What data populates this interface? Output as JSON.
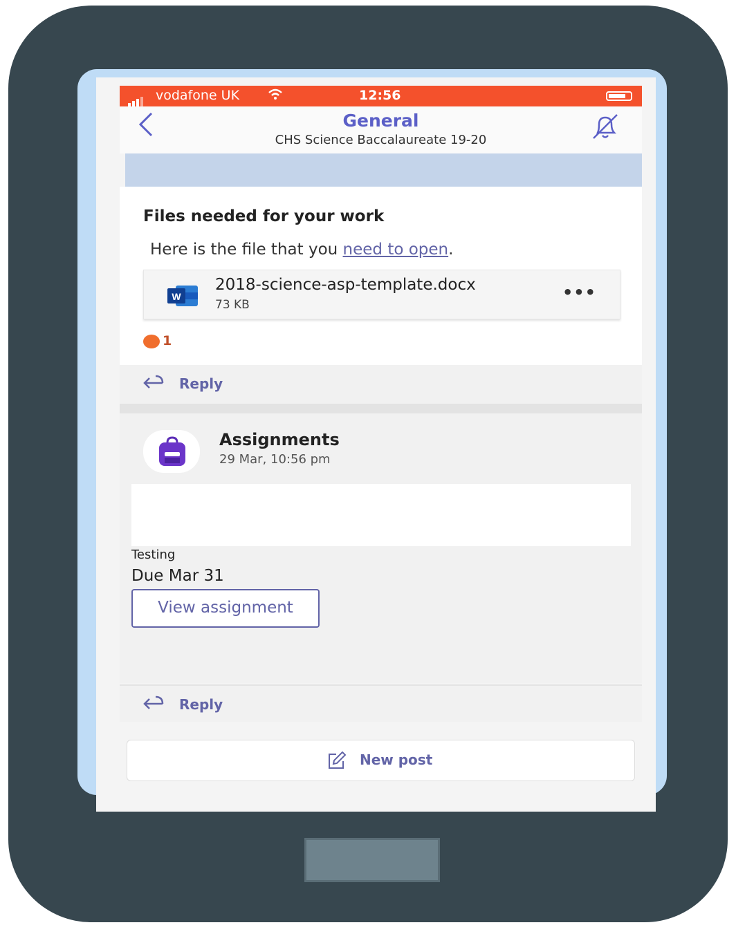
{
  "status_bar": {
    "carrier": "vodafone UK",
    "time": "12:56",
    "wifi_icon": "wifi-icon",
    "accent": "#f4512c"
  },
  "header": {
    "channel": "General",
    "team": "CHS Science Baccalaureate 19-20",
    "back_icon": "chevron-left-icon",
    "bell_icon": "bell-muted-icon",
    "accent": "#5b5fc7"
  },
  "message": {
    "subject": "Files needed for your work",
    "body_prefix": "Here is the file that you ",
    "body_link": "need to open",
    "body_suffix": ".",
    "file": {
      "name": "2018-science-asp-template.docx",
      "size": "73 KB",
      "more": "•••"
    },
    "reaction_count": "1"
  },
  "reply_label": "Reply",
  "assignment": {
    "sender": "Assignments",
    "timestamp": "29 Mar, 10:56 pm",
    "title": "Testing",
    "due": "Due Mar 31",
    "button": "View assignment"
  },
  "new_post": "New post"
}
